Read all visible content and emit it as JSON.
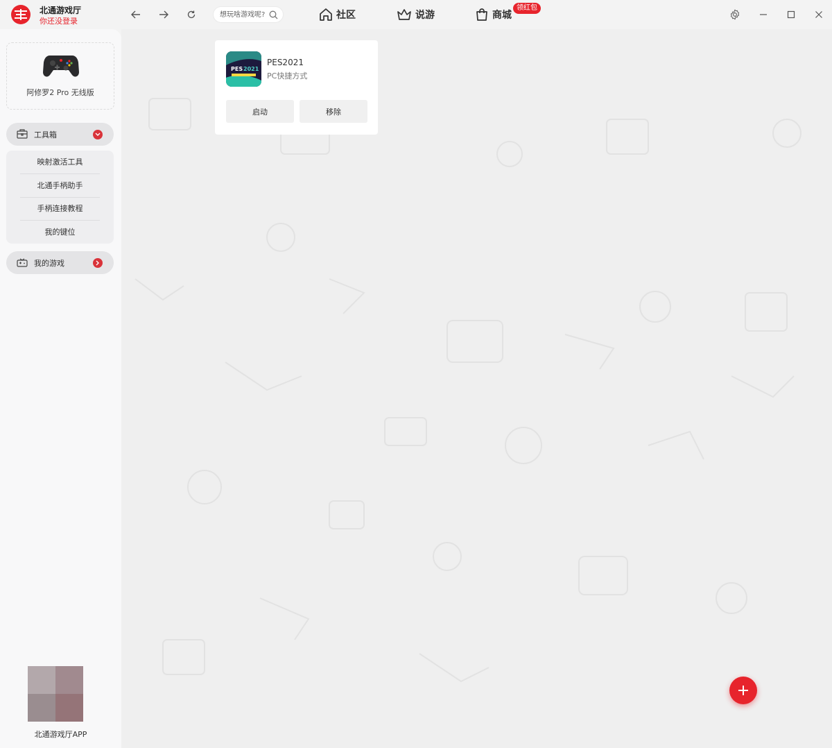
{
  "app": {
    "name": "北通游戏厅",
    "login_hint": "你还没登录",
    "brand_color": "#e7242c"
  },
  "toolbar": {
    "back_icon": "arrow-left-icon",
    "forward_icon": "arrow-right-icon",
    "refresh_icon": "refresh-icon"
  },
  "search": {
    "placeholder": "想玩啥游戏呢?",
    "icon": "search-icon"
  },
  "topnav": {
    "community": "社区",
    "talk": "说游",
    "shop": "商城",
    "shop_badge": "领红包"
  },
  "window": {
    "settings_icon": "gear-icon",
    "minimize_icon": "minimize-icon",
    "maximize_icon": "maximize-icon",
    "close_icon": "close-icon"
  },
  "sidebar": {
    "device_name": "阿修罗2 Pro 无线版",
    "toolbox_label": "工具箱",
    "toolbox_items": [
      "映射激活工具",
      "北通手柄助手",
      "手柄连接教程",
      "我的键位"
    ],
    "mygames_label": "我的游戏",
    "qr_caption": "北通游戏厅APP"
  },
  "game_card": {
    "title": "PES2021",
    "subtitle": "PC快捷方式",
    "launch_label": "启动",
    "remove_label": "移除"
  },
  "fab": {
    "icon": "plus-icon"
  }
}
